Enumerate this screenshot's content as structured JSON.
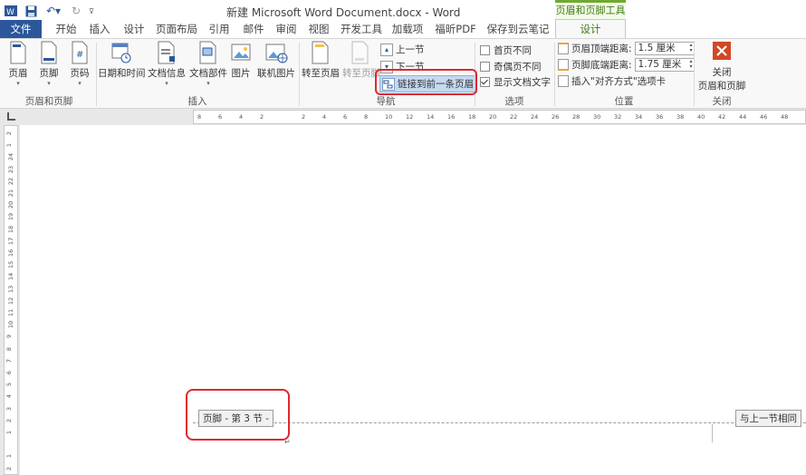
{
  "titlebar": {
    "doc_title": "新建 Microsoft Word Document.docx - Word",
    "context_group": "页眉和页脚工具"
  },
  "tabs": [
    {
      "label": "文件"
    },
    {
      "label": "开始"
    },
    {
      "label": "插入"
    },
    {
      "label": "设计"
    },
    {
      "label": "页面布局"
    },
    {
      "label": "引用"
    },
    {
      "label": "邮件"
    },
    {
      "label": "审阅"
    },
    {
      "label": "视图"
    },
    {
      "label": "开发工具"
    },
    {
      "label": "加载项"
    },
    {
      "label": "福昕PDF"
    },
    {
      "label": "保存到云笔记"
    },
    {
      "label": "设计"
    }
  ],
  "ribbon": {
    "group1": {
      "label": "页眉和页脚",
      "buttons": [
        "页眉",
        "页脚",
        "页码"
      ]
    },
    "group2": {
      "label": "插入",
      "buttons": [
        "日期和时间",
        "文档信息",
        "文档部件",
        "图片",
        "联机图片"
      ]
    },
    "group3": {
      "label": "导航",
      "goto_header": "转至页眉",
      "goto_footer": "转至页脚",
      "prev": "上一节",
      "next": "下一节",
      "link_prev": "链接到前一条页眉"
    },
    "group4": {
      "label": "选项",
      "opt1": "首页不同",
      "opt1_checked": false,
      "opt2": "奇偶页不同",
      "opt2_checked": false,
      "opt3": "显示文档文字",
      "opt3_checked": true
    },
    "group5": {
      "label": "位置",
      "header_dist_label": "页眉顶端距离:",
      "header_dist_value": "1.5 厘米",
      "footer_dist_label": "页脚底端距离:",
      "footer_dist_value": "1.75 厘米",
      "insert_align": "插入\"对齐方式\"选项卡"
    },
    "group6": {
      "label": "关闭",
      "close_line1": "关闭",
      "close_line2": "页眉和页脚"
    }
  },
  "document": {
    "footer_tag": "页脚 - 第 3 节 -",
    "same_as_prev": "与上一节相同"
  },
  "colors": {
    "accent": "#2b579a",
    "context": "#6faa2f",
    "highlight": "#e0282e"
  }
}
